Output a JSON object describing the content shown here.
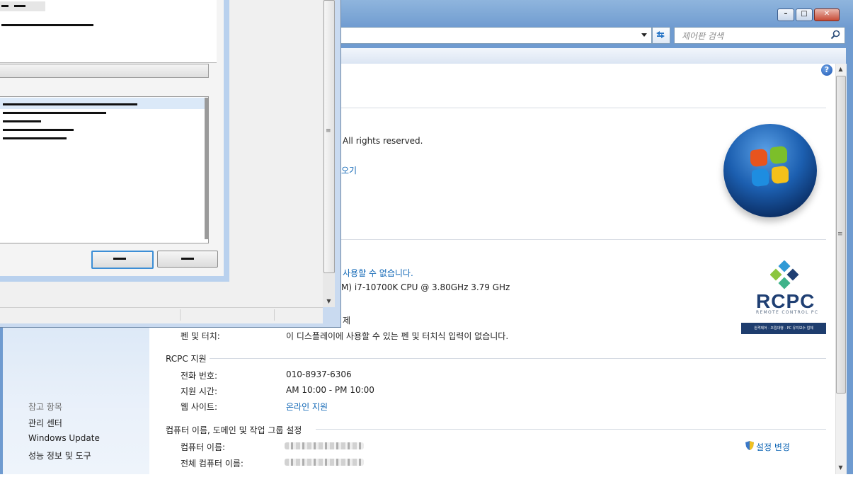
{
  "search": {
    "placeholder": "제어판 검색"
  },
  "window_buttons": {
    "minimize": "–",
    "maximize": "□",
    "close": "✕"
  },
  "system": {
    "copyright_partial": "All rights reserved.",
    "link_partial": "오기",
    "pen_partial_link": "사용할 수 없습니다.",
    "cpu_partial": "M) i7-10700K CPU @ 3.80GHz   3.79 GHz",
    "section_partial": "제",
    "pen_label": "펜 및 터치:",
    "pen_value": "이 디스플레이에 사용할 수 있는 펜 및 터치식 입력이 없습니다."
  },
  "support": {
    "section_title": "RCPC 지원",
    "phone_label": "전화 번호:",
    "phone_value": "010-8937-6306",
    "hours_label": "지원 시간:",
    "hours_value": "AM 10:00 - PM 10:00",
    "web_label": "웹 사이트:",
    "web_value": "온라인 지원"
  },
  "computer": {
    "section_title": "컴퓨터 이름, 도메인 및 작업 그룹 설정",
    "name_label": "컴퓨터 이름:",
    "full_name_label": "전체 컴퓨터 이름:",
    "change_settings": "설정 변경"
  },
  "left_pane": {
    "see_also": "참고 항목",
    "items": [
      "관리 센터",
      "Windows Update",
      "성능 정보 및 도구"
    ]
  },
  "rcpc_logo": {
    "brand": "RCPC",
    "tagline": "REMOTE CONTROL PC",
    "banner": "원격제어 · 조립대행 · PC 유지보수 업체"
  },
  "help": {
    "label": "?"
  },
  "colors": {
    "link": "#0f66b5",
    "brand_navy": "#1e3d6e",
    "accent_blue": "#3c8ed6"
  },
  "icons": [
    "help-icon",
    "search-icon",
    "refresh-icon",
    "dropdown-icon",
    "shield-icon",
    "windows-logo",
    "rcpc-logo"
  ]
}
